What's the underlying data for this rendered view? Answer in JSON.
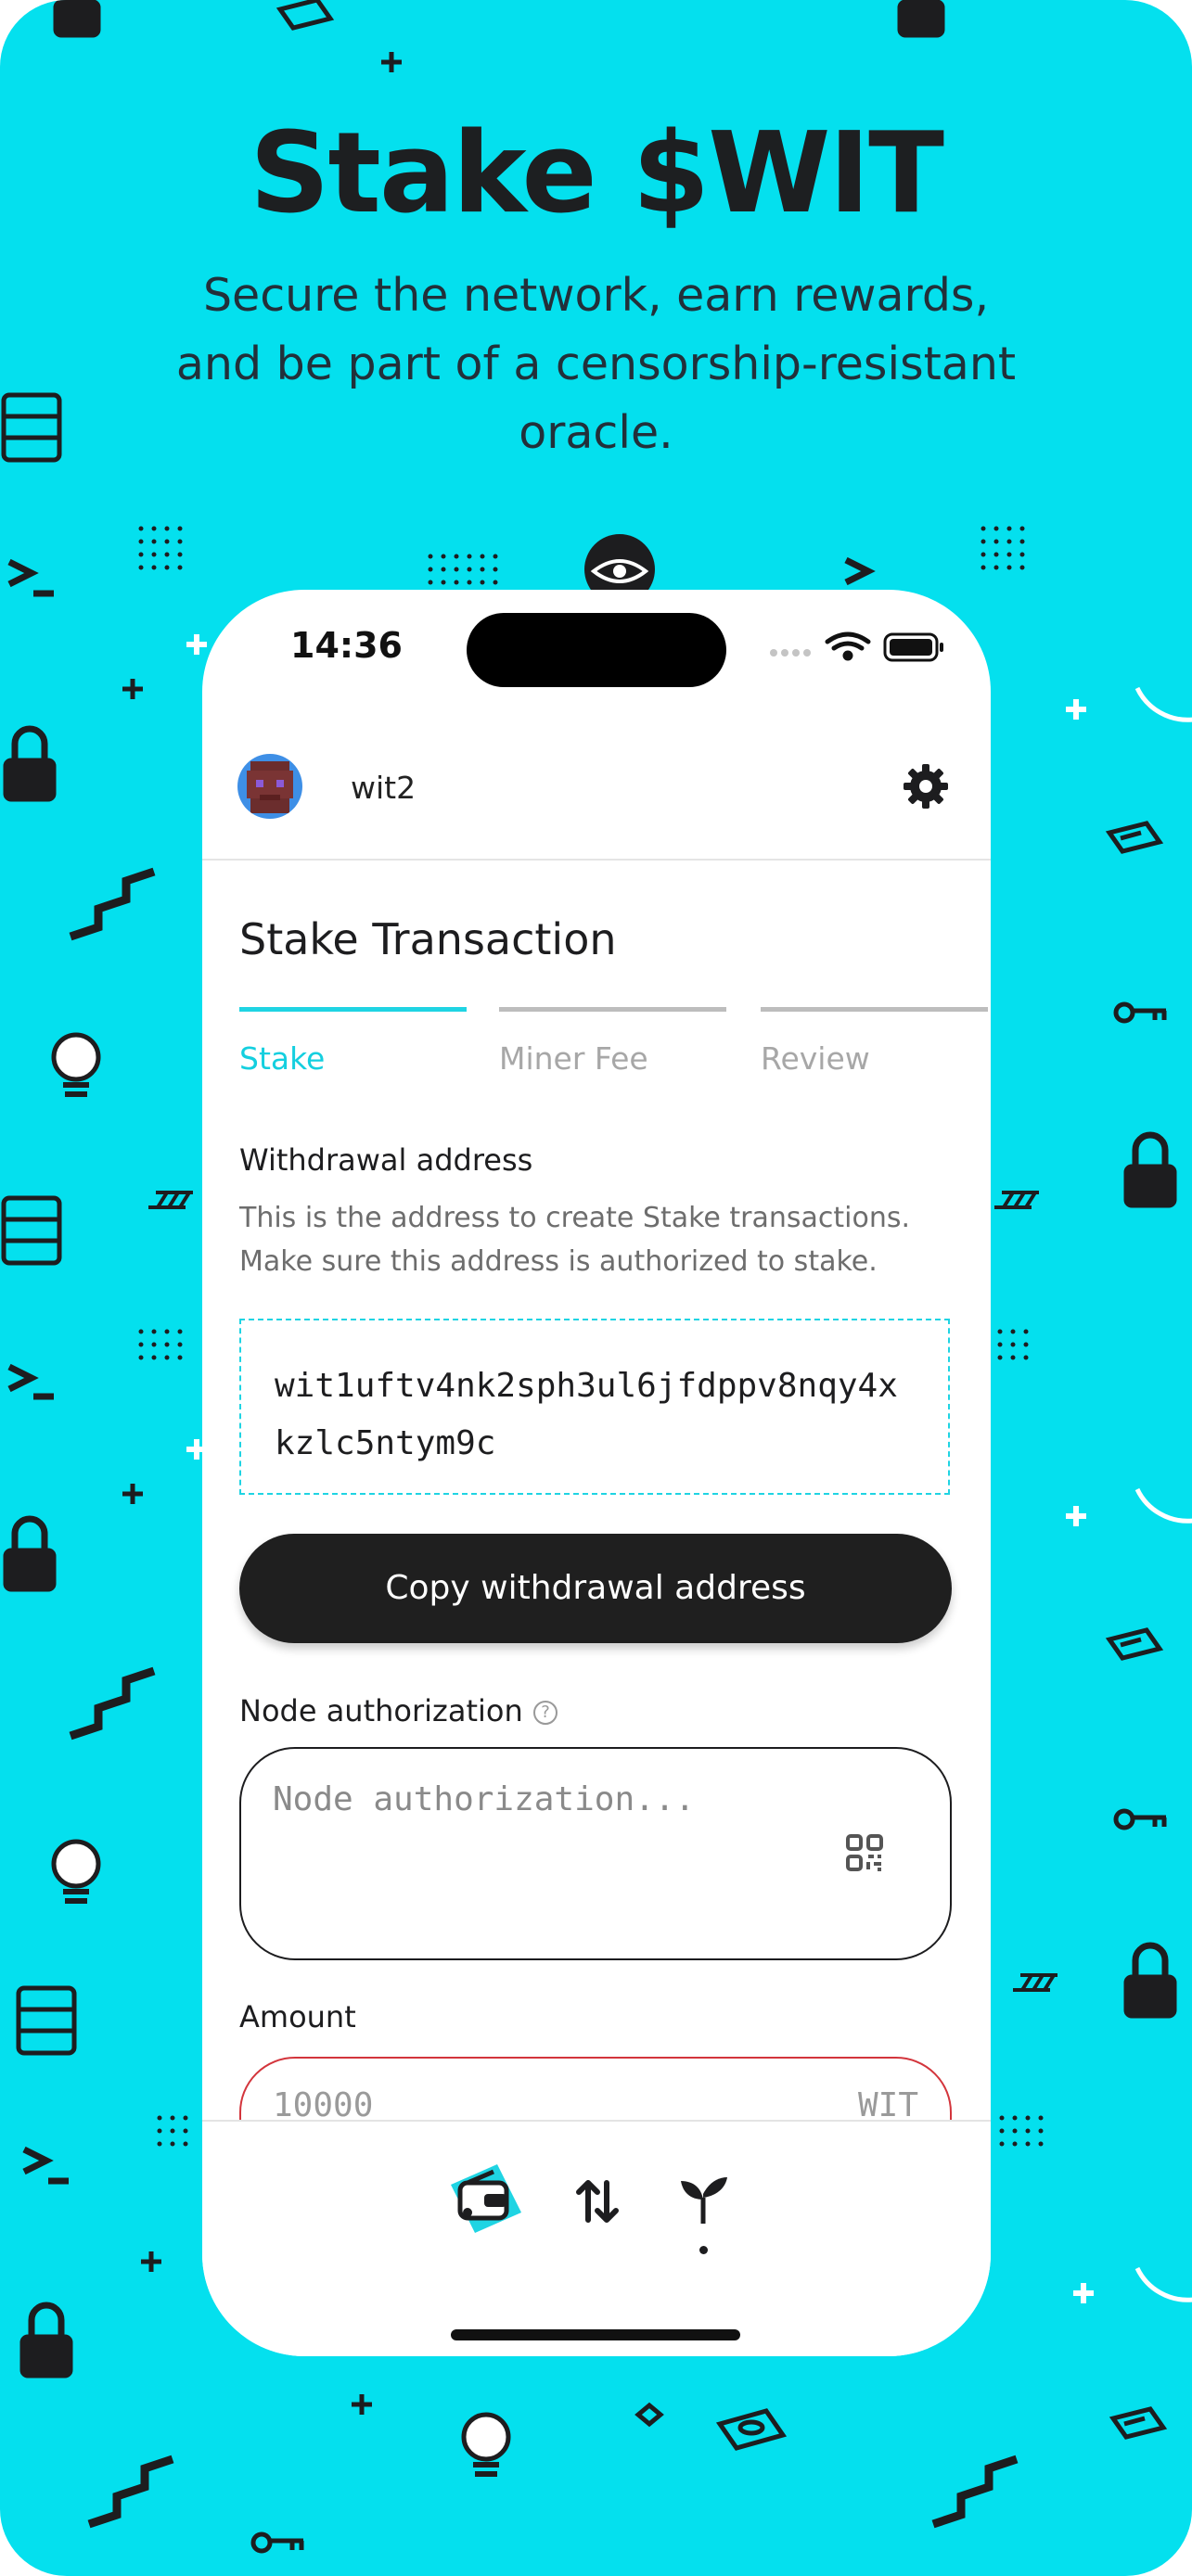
{
  "promo": {
    "headline": "Stake $WIT",
    "subheadline": "Secure the network, earn rewards, and be part of a censorship-resistant oracle.",
    "background_color": "#04e0ee"
  },
  "status_bar": {
    "time": "14:36",
    "icons": [
      "cellular-signal-icon",
      "wifi-icon",
      "battery-icon"
    ]
  },
  "app_bar": {
    "wallet_name": "wit2",
    "settings_icon": "gear-icon"
  },
  "page": {
    "title": "Stake Transaction",
    "steps": [
      {
        "label": "Stake",
        "active": true
      },
      {
        "label": "Miner Fee",
        "active": false
      },
      {
        "label": "Review",
        "active": false
      }
    ]
  },
  "withdrawal": {
    "label": "Withdrawal address",
    "description": "This is the address to create Stake transactions. Make sure this address is authorized to stake.",
    "address": "wit1uftv4nk2sph3ul6jfdppv8nqy4xkzlc5ntym9c",
    "copy_button": "Copy withdrawal address"
  },
  "node_authorization": {
    "label": "Node authorization",
    "placeholder": "Node authorization...",
    "help_icon": "?",
    "scan_icon": "qr-scan-icon"
  },
  "amount": {
    "label": "Amount",
    "placeholder": "10000",
    "unit": "WIT",
    "error_color": "#d3353c"
  },
  "bottom_nav": {
    "items": [
      {
        "icon": "wallet-icon",
        "active": false
      },
      {
        "icon": "transfer-arrows-icon",
        "active": false
      },
      {
        "icon": "sprout-icon",
        "active": true
      }
    ]
  },
  "colors": {
    "accent": "#1fd4e3",
    "button": "#1f1f1f"
  }
}
